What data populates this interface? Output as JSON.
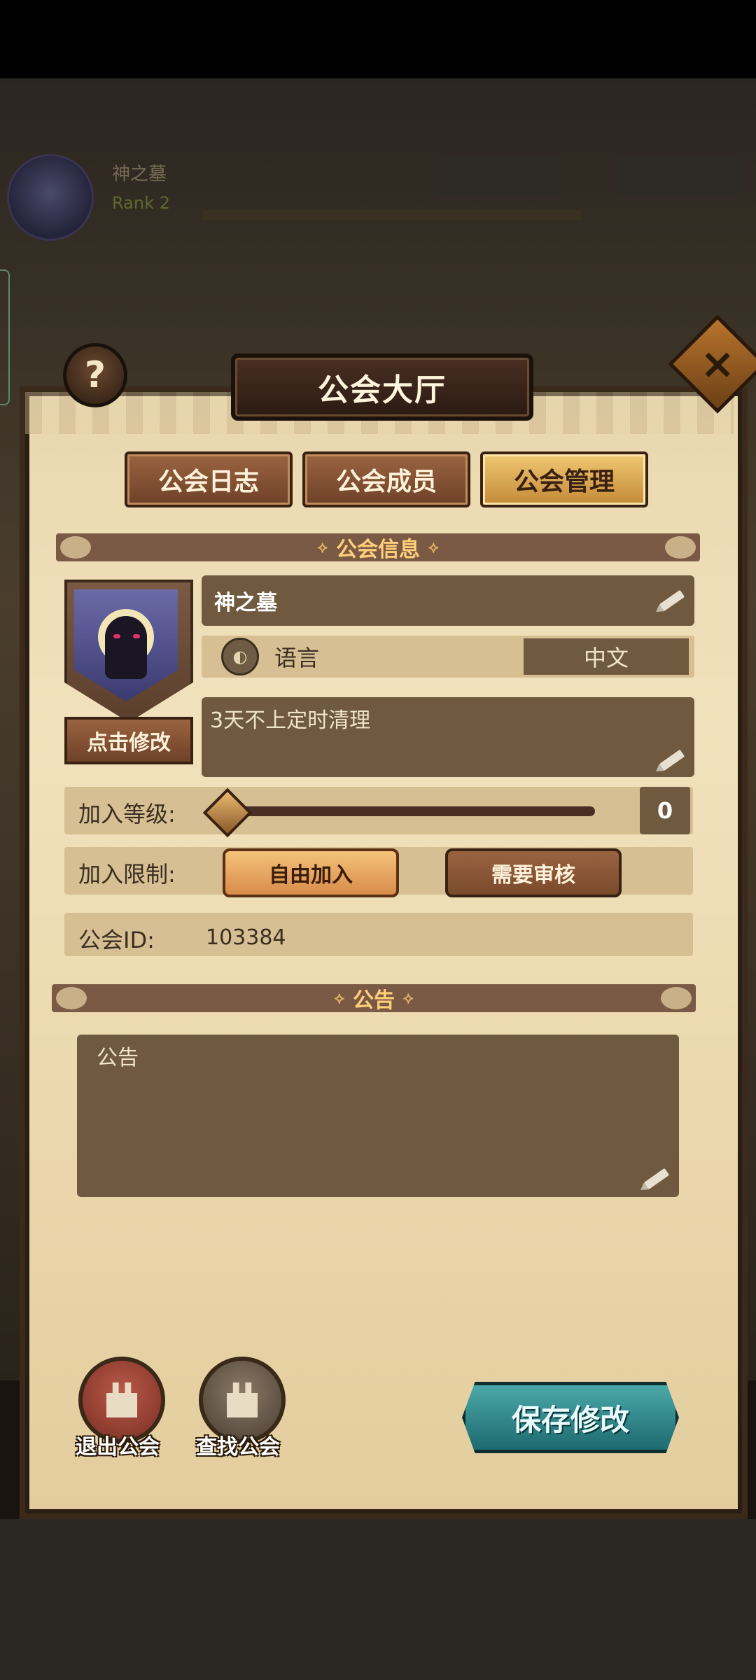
{
  "window": {
    "title": "公会大厅"
  },
  "background": {
    "player_name": "神之墓",
    "rank_text": "Rank 2"
  },
  "tabs": [
    {
      "label": "公会日志",
      "active": false
    },
    {
      "label": "公会成员",
      "active": false
    },
    {
      "label": "公会管理",
      "active": true
    }
  ],
  "guild_info": {
    "section_title": "公会信息",
    "edit_emblem_label": "点击修改",
    "name": "神之墓",
    "language_label": "语言",
    "language_value": "中文",
    "description": "3天不上定时清理",
    "join_level_label": "加入等级:",
    "join_level_value": "0",
    "join_level_fraction": 0,
    "join_limit_label": "加入限制:",
    "join_free_label": "自由加入",
    "join_approve_label": "需要审核",
    "guild_id_label": "公会ID:",
    "guild_id_value": "103384"
  },
  "notice": {
    "section_title": "公告",
    "text": "公告"
  },
  "actions": {
    "exit_guild_label": "退出公会",
    "find_guild_label": "查找公会",
    "save_label": "保存修改"
  },
  "colors": {
    "panel": "#ecd9ae",
    "field": "#6f5a40",
    "accent_active": "#f0c872",
    "save_button": "#2e8a8e"
  },
  "icons": [
    "help-icon",
    "close-icon",
    "pencil-icon",
    "globe-icon",
    "castle-exit-icon",
    "castle-search-icon",
    "guild-emblem-cat"
  ]
}
